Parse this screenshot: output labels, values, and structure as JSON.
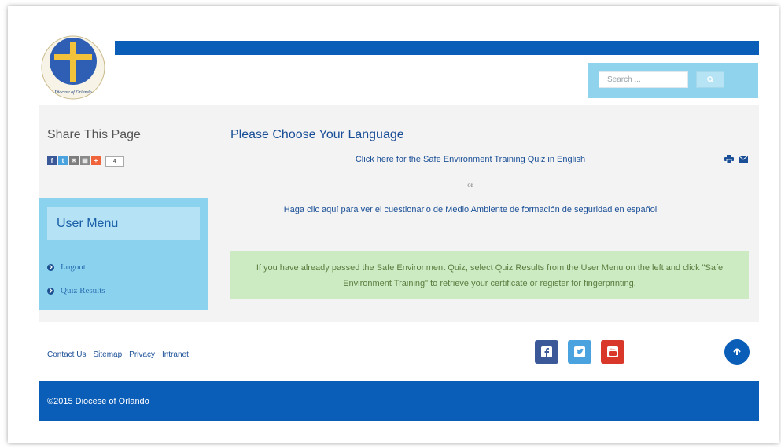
{
  "header": {
    "logo_text": "Diocese of Orlando",
    "search_placeholder": "Search ...",
    "search_icon": "search-icon"
  },
  "share": {
    "title": "Share This Page",
    "icons": [
      "facebook-icon",
      "twitter-icon",
      "email-icon",
      "print-icon",
      "plus-icon"
    ],
    "count": "4"
  },
  "user_menu": {
    "title": "User Menu",
    "items": [
      {
        "label": "Logout"
      },
      {
        "label": "Quiz Results"
      }
    ]
  },
  "main": {
    "title": "Please Choose Your Language",
    "english_link": "Click here for the Safe Environment Training Quiz in English",
    "or_text": "or",
    "spanish_link": "Haga clic aquí para ver el cuestionario de Medio Ambiente de formación de seguridad en español",
    "notice": "If you have already passed the Safe Environment Quiz, select Quiz Results from the User Menu on the left and click \"Safe Environment Training\" to retrieve your certificate or register for fingerprinting."
  },
  "footer": {
    "links": [
      "Contact Us",
      "Sitemap",
      "Privacy",
      "Intranet"
    ],
    "social": [
      {
        "name": "facebook",
        "color": "#3b5998"
      },
      {
        "name": "twitter",
        "color": "#4aa3df"
      },
      {
        "name": "youtube",
        "color": "#d9372a"
      }
    ],
    "copyright": "©2015 Diocese of Orlando"
  },
  "colors": {
    "brand_blue": "#0b5eb8",
    "light_blue": "#8bd2ee",
    "notice_green": "#cdebc3"
  }
}
